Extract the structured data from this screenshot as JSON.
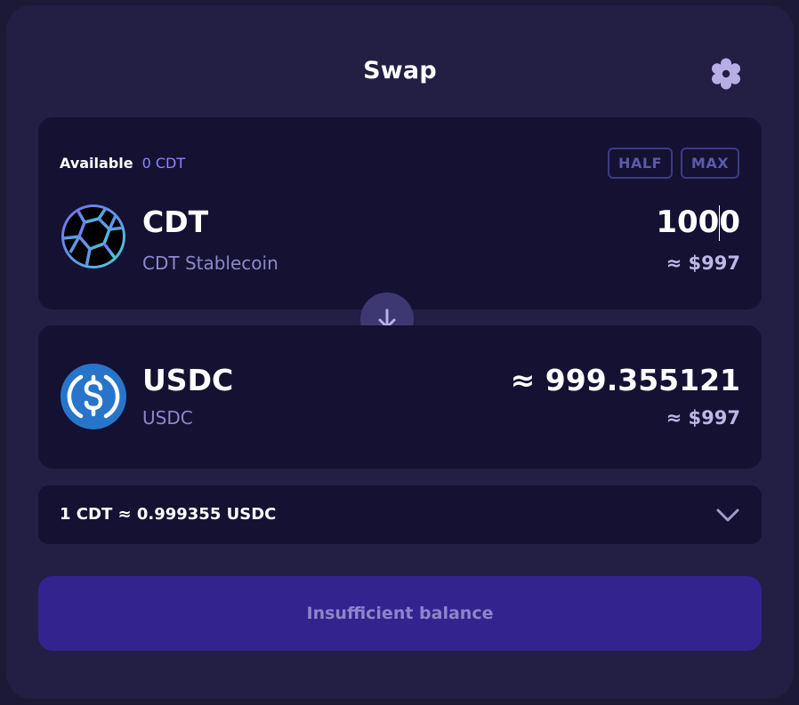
{
  "modal": {
    "title": "Swap"
  },
  "from": {
    "available_label": "Available",
    "available_amount": "0 CDT",
    "half_label": "HALF",
    "max_label": "MAX",
    "symbol": "CDT",
    "name": "CDT Stablecoin",
    "amount": "1000",
    "usd_value": "≈ $997",
    "icon": "cdt-token-icon"
  },
  "to": {
    "symbol": "USDC",
    "name": "USDC",
    "amount": "≈ 999.355121",
    "usd_value": "≈ $997",
    "icon": "usdc-token-icon"
  },
  "rate": {
    "text": "1 CDT ≈ 0.999355 USDC"
  },
  "cta": {
    "label": "Insufficient balance"
  },
  "colors": {
    "modal_bg": "#221e44",
    "card_bg": "#141133",
    "accent": "#8b85ff",
    "cta_bg": "#32238f",
    "usdc_blue": "#2775ca"
  }
}
